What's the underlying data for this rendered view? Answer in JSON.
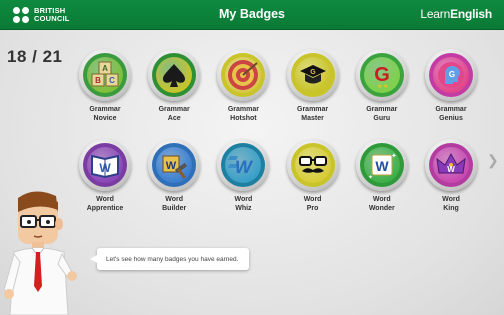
{
  "header": {
    "brand_line1": "BRITISH",
    "brand_line2": "COUNCIL",
    "title": "My Badges",
    "learn_prefix": "Learn",
    "learn_suffix": "English"
  },
  "progress": "18 / 21",
  "colors": {
    "header_green": "#0c8239",
    "label_text": "#333333"
  },
  "badges": [
    {
      "line1": "Grammar",
      "line2": "Novice",
      "icon": "abc-blocks-icon",
      "ring": "#3a9a3e"
    },
    {
      "line1": "Grammar",
      "line2": "Ace",
      "icon": "spade-icon",
      "ring": "#2f8f35"
    },
    {
      "line1": "Grammar",
      "line2": "Hotshot",
      "icon": "target-icon",
      "ring": "#c8c42a"
    },
    {
      "line1": "Grammar",
      "line2": "Master",
      "icon": "graduation-cap-icon",
      "ring": "#c8c42a"
    },
    {
      "line1": "Grammar",
      "line2": "Guru",
      "icon": "letter-g-stars-icon",
      "ring": "#3aa33e"
    },
    {
      "line1": "Grammar",
      "line2": "Genius",
      "icon": "brain-head-icon",
      "ring": "#c23ca4"
    },
    {
      "line1": "Word",
      "line2": "Apprentice",
      "icon": "open-book-icon",
      "ring": "#7a3ca0"
    },
    {
      "line1": "Word",
      "line2": "Builder",
      "icon": "hammer-w-icon",
      "ring": "#2f6fb8"
    },
    {
      "line1": "Word",
      "line2": "Whiz",
      "icon": "fast-w-icon",
      "ring": "#1e7fa0"
    },
    {
      "line1": "Word",
      "line2": "Pro",
      "icon": "glasses-mustache-icon",
      "ring": "#c8c42a"
    },
    {
      "line1": "Word",
      "line2": "Wonder",
      "icon": "sparkle-w-icon",
      "ring": "#2f9a3a"
    },
    {
      "line1": "Word",
      "line2": "King",
      "icon": "crown-icon",
      "ring": "#b23ca0"
    }
  ],
  "speech": "Let's see how many badges you have earned."
}
